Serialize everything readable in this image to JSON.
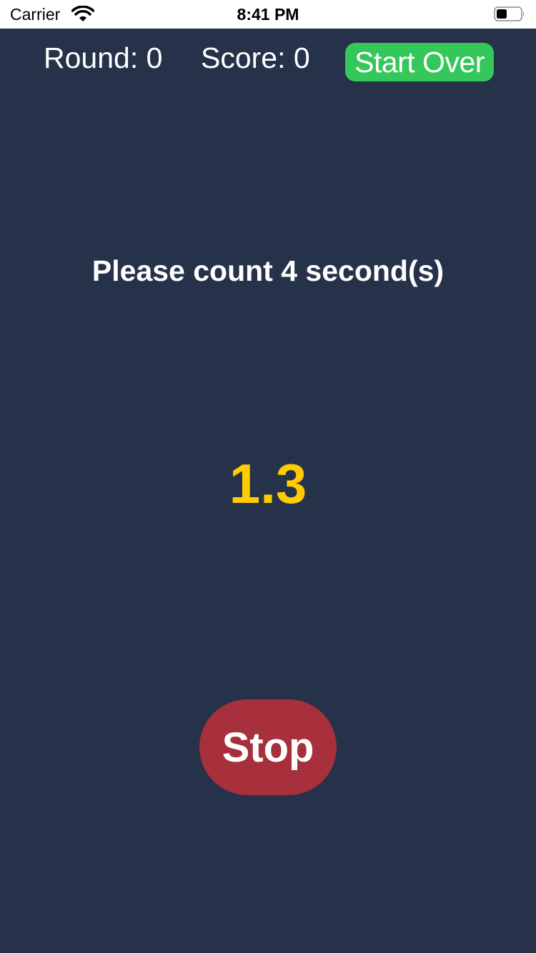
{
  "status_bar": {
    "carrier": "Carrier",
    "time": "8:41 PM",
    "icons": [
      "wifi-icon",
      "battery-icon"
    ]
  },
  "header": {
    "round_label": "Round: 0",
    "score_label": "Score: 0",
    "start_over_label": "Start Over"
  },
  "main": {
    "prompt": "Please count 4 second(s)",
    "timer_value": "1.3",
    "stop_label": "Stop"
  },
  "colors": {
    "background": "#25324a",
    "start_over_button": "#34c759",
    "stop_button": "#a8303c",
    "timer_text": "#ffcc00",
    "text": "#ffffff"
  }
}
